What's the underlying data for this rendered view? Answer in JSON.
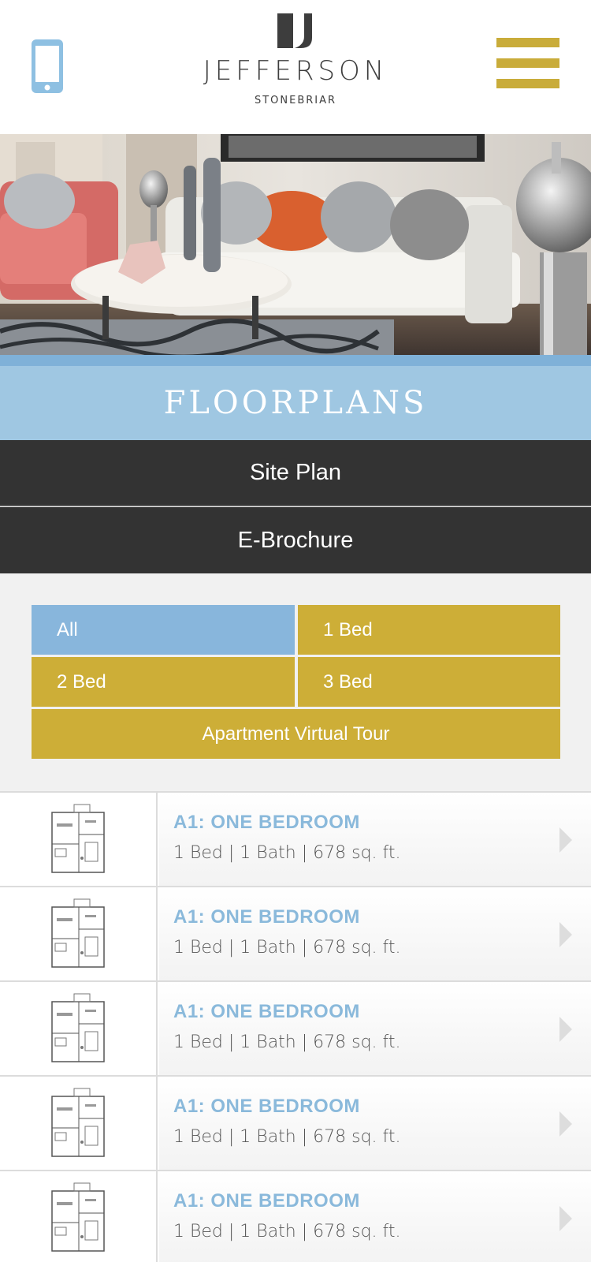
{
  "header": {
    "logo_name": "JEFFERSON",
    "logo_sub": "STONEBRIAR",
    "phone_icon": "phone-icon",
    "menu_icon": "hamburger-menu-icon",
    "colors": {
      "gold": "#c9ac3a",
      "blue": "#7fb1d8",
      "dark": "#333333"
    }
  },
  "page": {
    "title": "FLOORPLANS"
  },
  "nav": {
    "site_plan": "Site Plan",
    "ebrochure": "E-Brochure"
  },
  "filters": {
    "all": "All",
    "one_bed": "1 Bed",
    "two_bed": "2 Bed",
    "three_bed": "3 Bed",
    "tour": "Apartment Virtual Tour",
    "selected": "All"
  },
  "floorplans": [
    {
      "title": "A1: ONE BEDROOM",
      "details": "1 Bed | 1 Bath | 678 sq. ft."
    },
    {
      "title": "A1: ONE BEDROOM",
      "details": "1 Bed | 1 Bath | 678 sq. ft."
    },
    {
      "title": "A1: ONE BEDROOM",
      "details": "1 Bed | 1 Bath | 678 sq. ft."
    },
    {
      "title": "A1: ONE BEDROOM",
      "details": "1 Bed | 1 Bath | 678 sq. ft."
    },
    {
      "title": "A1: ONE BEDROOM",
      "details": "1 Bed | 1 Bath | 678 sq. ft."
    }
  ]
}
